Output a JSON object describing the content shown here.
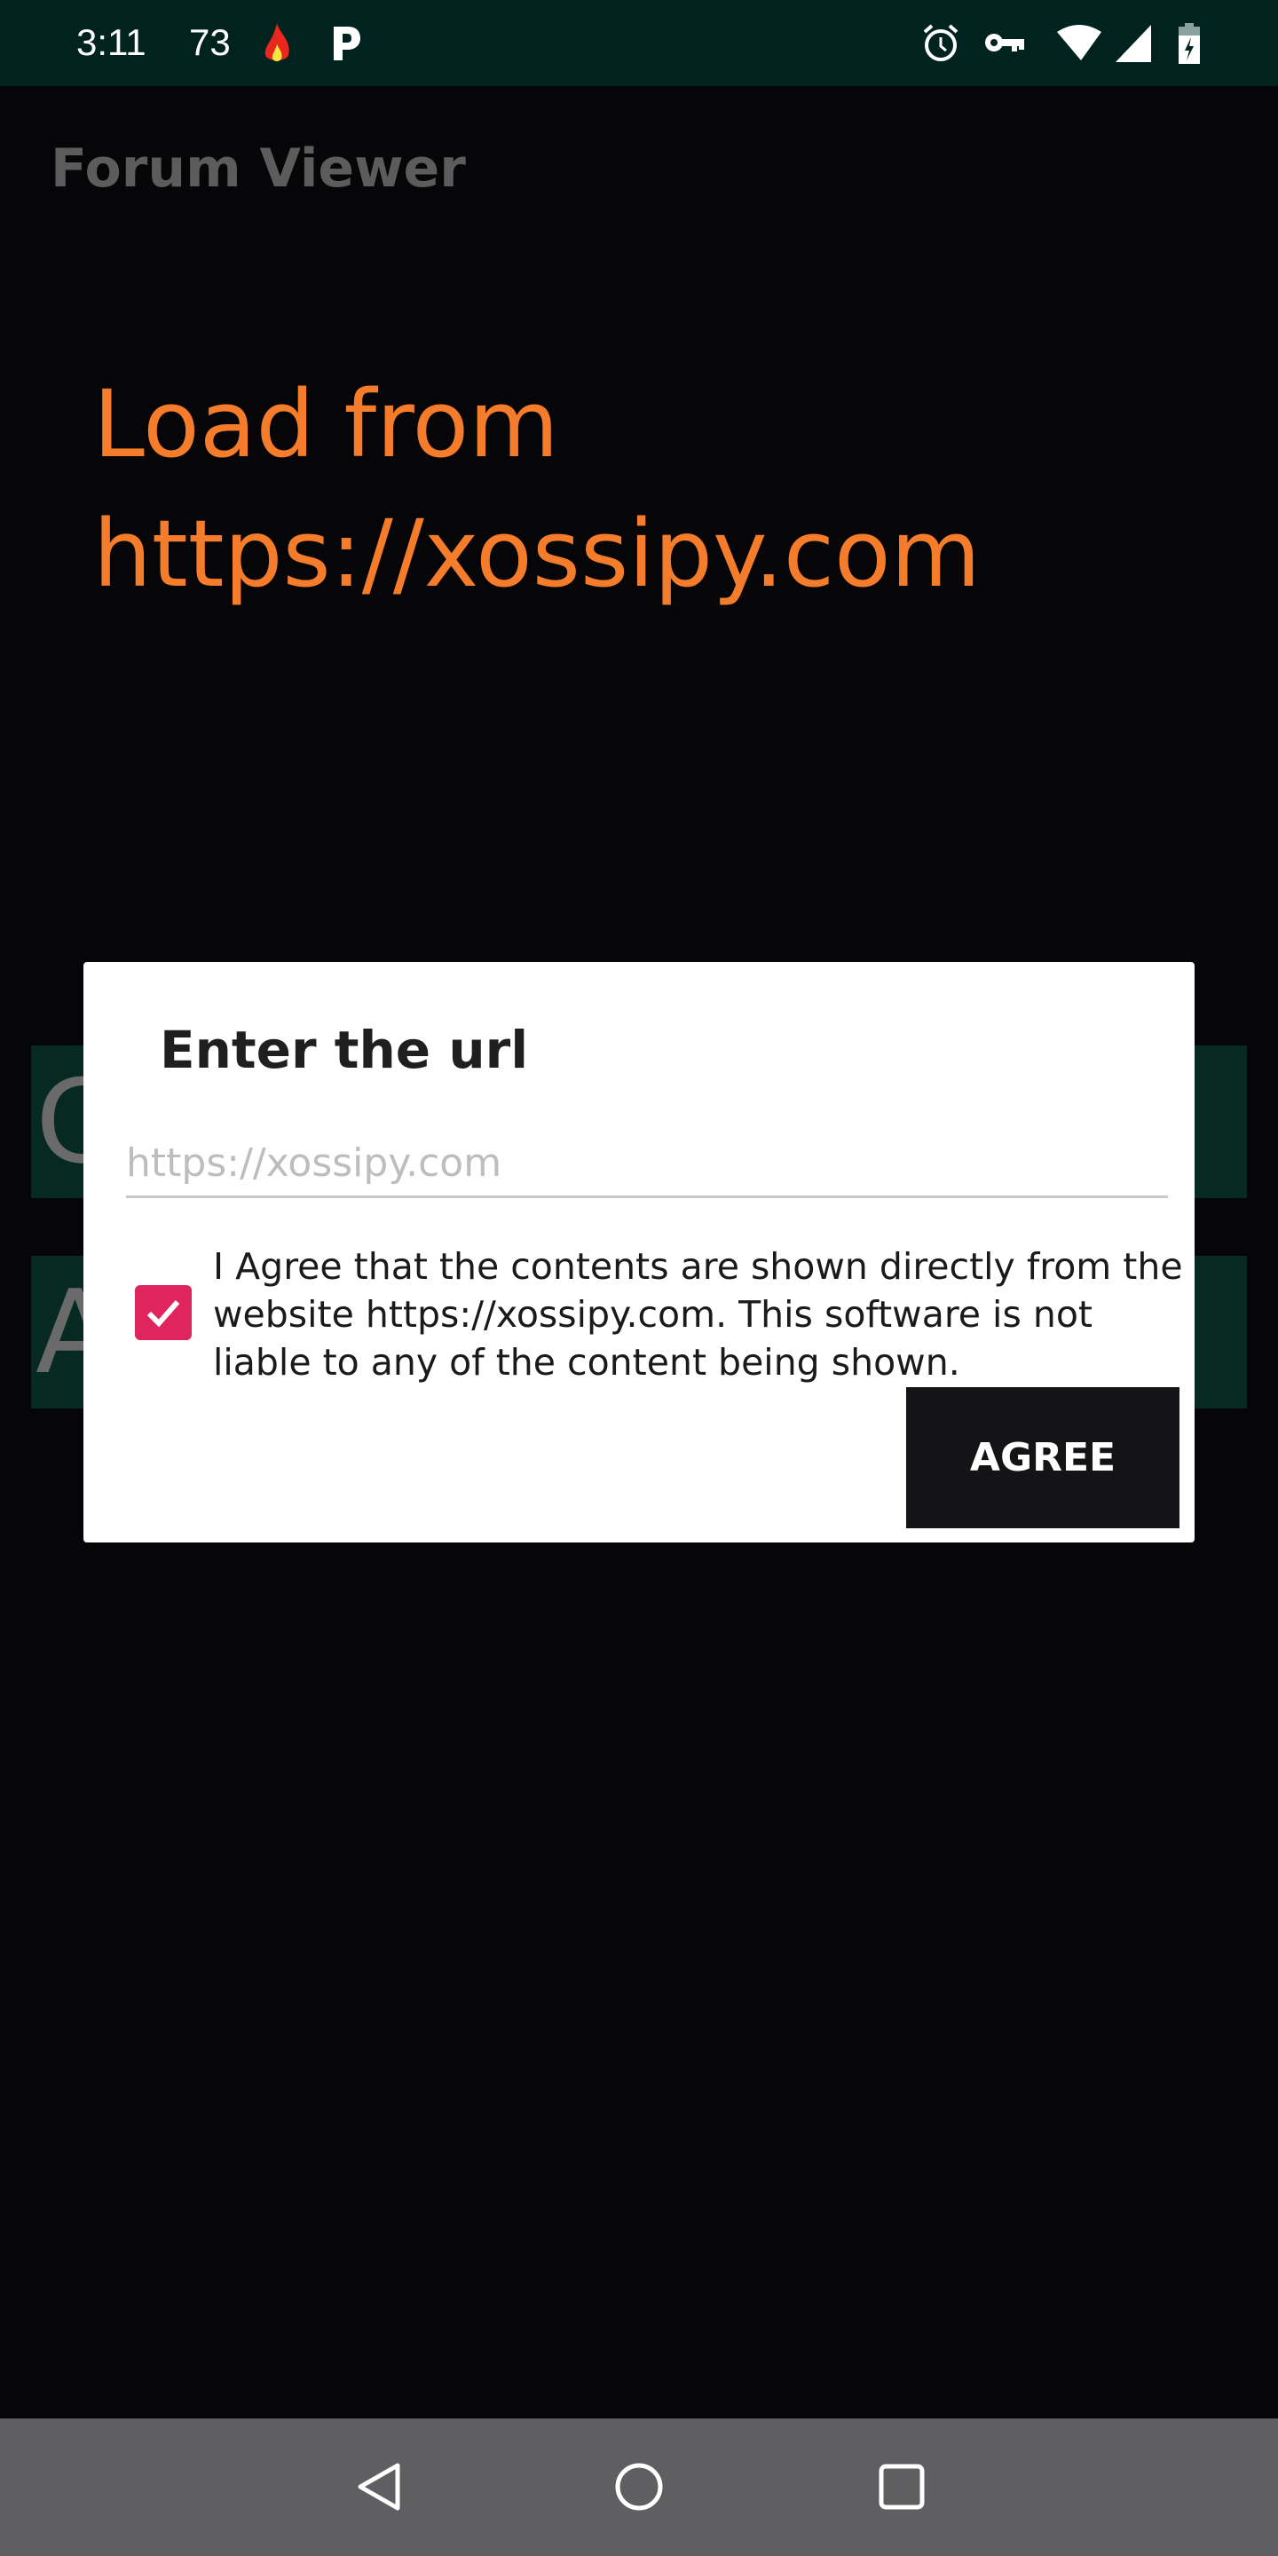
{
  "status_bar": {
    "time": "3:11",
    "temperature": "73",
    "icons": [
      "flame-icon",
      "p-app-icon",
      "alarm-icon",
      "vpn-key-icon",
      "wifi-icon",
      "signal-icon",
      "battery-charging-icon"
    ]
  },
  "app": {
    "title": "Forum Viewer"
  },
  "main": {
    "load_line1": "Load from",
    "load_line2": "https://xossipy.com",
    "bg_button_1": "G",
    "bg_button_2": "A"
  },
  "dialog": {
    "title": "Enter the url",
    "url_placeholder": "https://xossipy.com",
    "url_value": "",
    "checkbox_checked": true,
    "agreement_text": "I Agree that the contents are shown directly from the website https://xossipy.com. This software is not liable to any of the content being shown.",
    "agree_label": "AGREE"
  },
  "colors": {
    "accent": "#f47c2a",
    "checkbox": "#e0245e",
    "status_bar": "#002320"
  },
  "nav_bar": {
    "icons": [
      "back-icon",
      "home-icon",
      "recents-icon"
    ]
  }
}
